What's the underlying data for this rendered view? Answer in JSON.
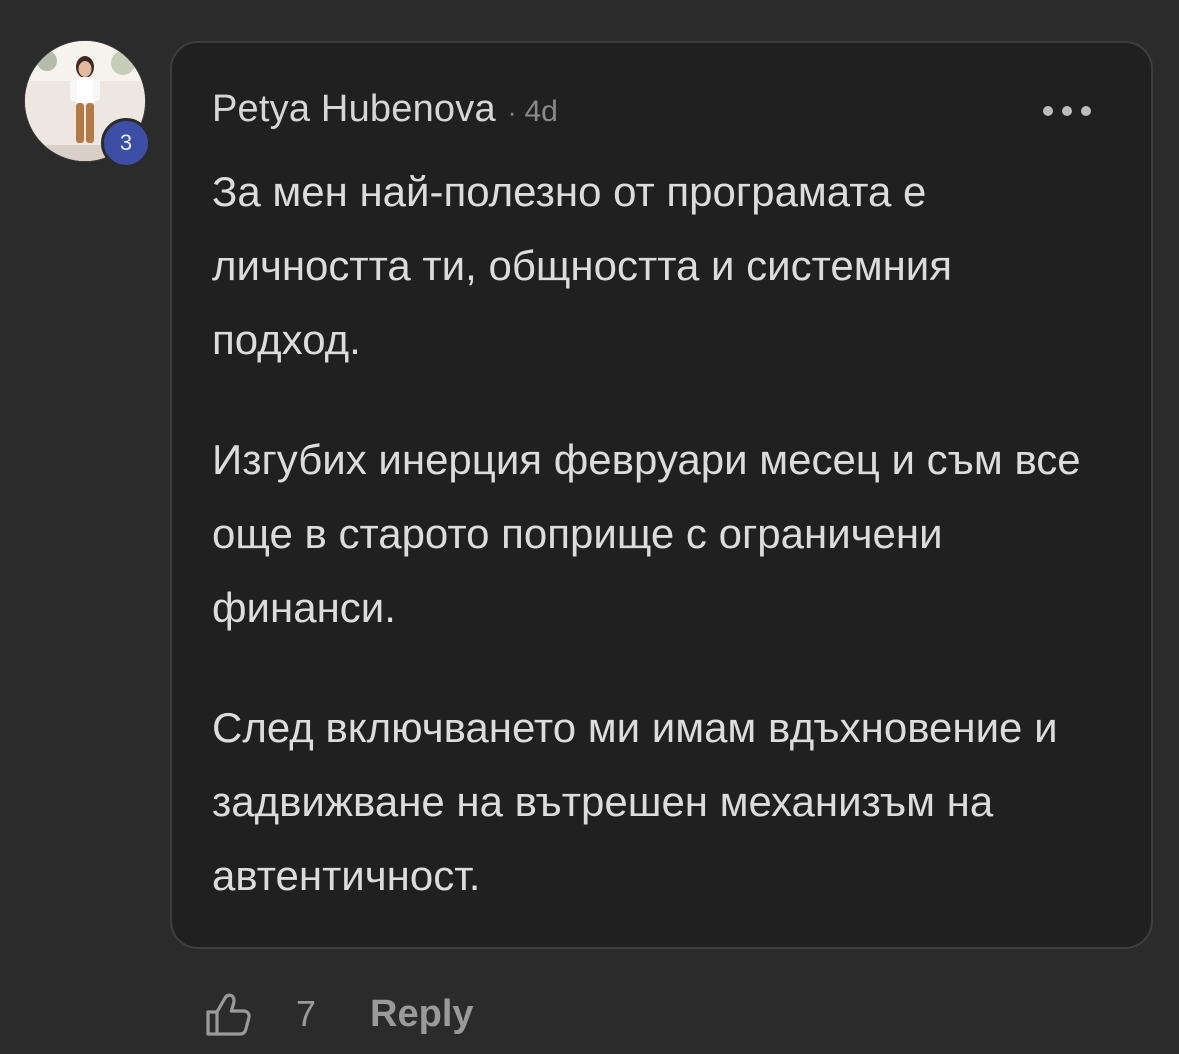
{
  "comment": {
    "author": "Petya Hubenova",
    "separator": "·",
    "time": "4d",
    "level": "3",
    "paragraphs": [
      "За мен най-полезно от програмата е личността ти, общността и системния подход.",
      "Изгубих инерция февруари месец и съм все още в старото поприще с ограничени финанси.",
      "След включването ми имам вдъхновение и задвижване на вътрешен механизъм на автентичност."
    ]
  },
  "actions": {
    "like_count": "7",
    "reply_label": "Reply"
  },
  "icons": {
    "like": "thumbs-up-icon",
    "more": "more-options-icon"
  },
  "colors": {
    "background": "#2b2b2b",
    "bubble": "#202020",
    "badge": "#3d4ea6",
    "text": "#dcdcdc",
    "muted": "#8a8a8a"
  }
}
